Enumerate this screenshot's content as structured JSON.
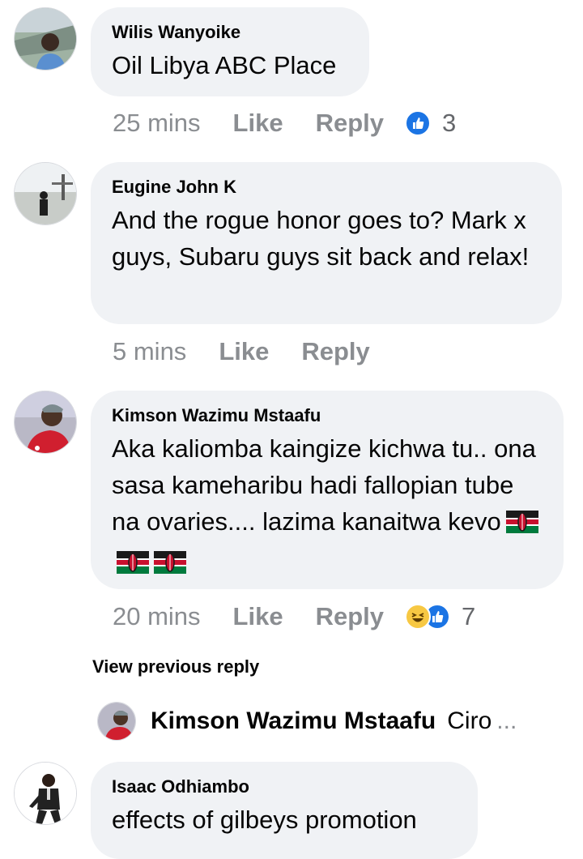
{
  "comments": [
    {
      "author": "Wilis Wanyoike",
      "text": "Oil Libya ABC Place",
      "time": "25 mins",
      "like_label": "Like",
      "reply_label": "Reply",
      "reaction_count": "3",
      "reactions": [
        "like-icon"
      ]
    },
    {
      "author": "Eugine John K",
      "text": "And the rogue honor goes to? Mark x guys, Subaru guys sit back and relax!",
      "time": "5 mins",
      "like_label": "Like",
      "reply_label": "Reply"
    },
    {
      "author": "Kimson Wazimu Mstaafu",
      "text": "Aka kaliomba kaingize kichwa tu.. ona sasa kameharibu hadi fallopian tube na ovaries.... lazima kanaitwa kevo",
      "emoji": [
        "kenya-flag",
        "kenya-flag",
        "kenya-flag"
      ],
      "time": "20 mins",
      "like_label": "Like",
      "reply_label": "Reply",
      "reaction_count": "7",
      "reactions": [
        "haha-icon",
        "like-icon"
      ]
    }
  ],
  "view_previous_reply": "View previous reply",
  "collapsed_reply": {
    "author": "Kimson Wazimu Mstaafu",
    "snippet": "Ciro",
    "ellipsis": "..."
  },
  "partial_comment": {
    "author": "Isaac Odhiambo",
    "text": "effects of gilbeys promotion"
  },
  "colors": {
    "bubble": "#f0f2f5",
    "meta_text": "#8a8d91",
    "like_blue": "#1b74e4",
    "haha_yellow": "#f7c843"
  }
}
